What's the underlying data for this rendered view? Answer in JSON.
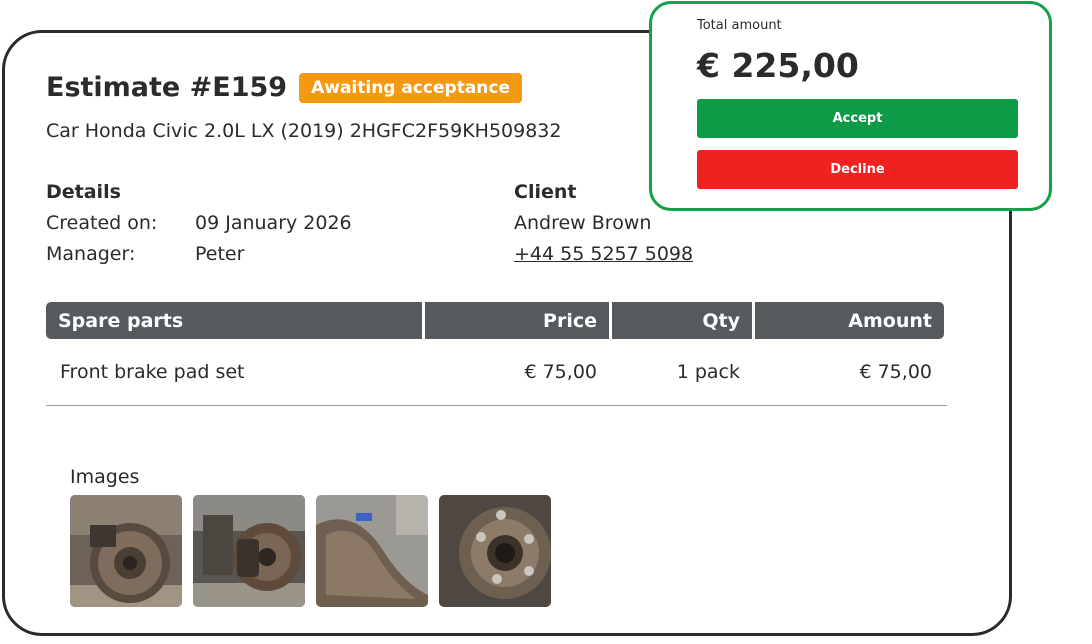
{
  "estimate": {
    "title": "Estimate #E159",
    "status": "Awaiting acceptance",
    "car": "Car Honda Civic 2.0L LX (2019) 2HGFC2F59KH509832"
  },
  "details": {
    "heading": "Details",
    "created_label": "Created on:",
    "created_value": "09 January 2026",
    "manager_label": "Manager:",
    "manager_value": "Peter"
  },
  "client": {
    "heading": "Client",
    "name": "Andrew Brown",
    "phone": "+44 55 5257 5098"
  },
  "parts_table": {
    "headers": [
      "Spare parts",
      "Price",
      "Qty",
      "Amount"
    ],
    "rows": [
      [
        "Front brake pad set",
        "€ 75,00",
        "1 pack",
        "€ 75,00"
      ]
    ]
  },
  "images": {
    "label": "Images"
  },
  "total": {
    "label": "Total amount",
    "value": "€ 225,00",
    "accept_label": "Accept",
    "decline_label": "Decline"
  },
  "colors": {
    "status_badge": "#f39a12",
    "accept": "#0f9a48",
    "decline": "#f02121",
    "panel_border": "#15a04a",
    "table_header": "#555a5e"
  }
}
